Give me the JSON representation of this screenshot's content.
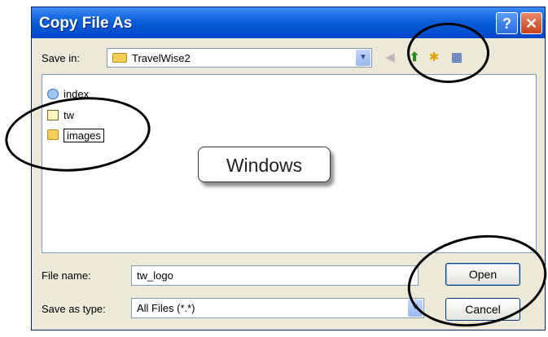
{
  "dialog": {
    "title": "Copy File As",
    "help_glyph": "?",
    "close_glyph": "✕"
  },
  "toolbar": {
    "save_in_label": "Save in:",
    "save_in_value": "TravelWise2",
    "icons": [
      "back-icon",
      "up-folder-icon",
      "new-folder-icon",
      "views-menu-icon"
    ]
  },
  "files": [
    {
      "name": "index",
      "icon": "html-file-icon"
    },
    {
      "name": "tw",
      "icon": "document-icon"
    },
    {
      "name": "images",
      "icon": "folder-icon"
    }
  ],
  "callout": {
    "text": "Windows"
  },
  "bottom": {
    "file_name_label": "File name:",
    "file_name_value": "tw_logo",
    "save_as_type_label": "Save as type:",
    "save_as_type_value": "All Files (*.*)",
    "open_label": "Open",
    "cancel_label": "Cancel"
  }
}
